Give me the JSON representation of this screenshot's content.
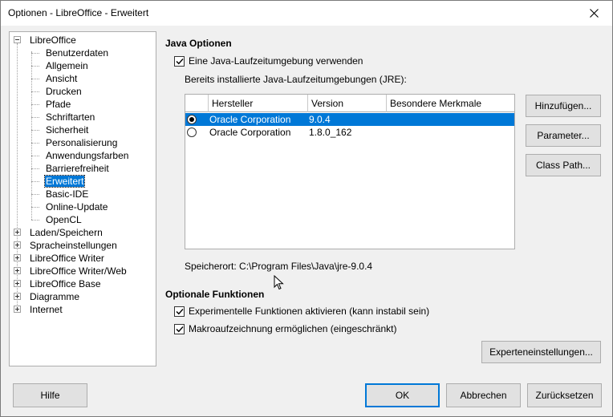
{
  "window": {
    "title": "Optionen - LibreOffice - Erweitert"
  },
  "tree": {
    "items": [
      {
        "label": "LibreOffice",
        "level": 0,
        "expander": "minus"
      },
      {
        "label": "Benutzerdaten",
        "level": 1
      },
      {
        "label": "Allgemein",
        "level": 1
      },
      {
        "label": "Ansicht",
        "level": 1
      },
      {
        "label": "Drucken",
        "level": 1
      },
      {
        "label": "Pfade",
        "level": 1
      },
      {
        "label": "Schriftarten",
        "level": 1
      },
      {
        "label": "Sicherheit",
        "level": 1
      },
      {
        "label": "Personalisierung",
        "level": 1
      },
      {
        "label": "Anwendungsfarben",
        "level": 1
      },
      {
        "label": "Barrierefreiheit",
        "level": 1
      },
      {
        "label": "Erweitert",
        "level": 1,
        "selected": true
      },
      {
        "label": "Basic-IDE",
        "level": 1
      },
      {
        "label": "Online-Update",
        "level": 1
      },
      {
        "label": "OpenCL",
        "level": 1
      },
      {
        "label": "Laden/Speichern",
        "level": 0,
        "expander": "plus"
      },
      {
        "label": "Spracheinstellungen",
        "level": 0,
        "expander": "plus"
      },
      {
        "label": "LibreOffice Writer",
        "level": 0,
        "expander": "plus"
      },
      {
        "label": "LibreOffice Writer/Web",
        "level": 0,
        "expander": "plus"
      },
      {
        "label": "LibreOffice Base",
        "level": 0,
        "expander": "plus"
      },
      {
        "label": "Diagramme",
        "level": 0,
        "expander": "plus"
      },
      {
        "label": "Internet",
        "level": 0,
        "expander": "plus"
      }
    ]
  },
  "java": {
    "section_title": "Java Optionen",
    "use_jre_label": "Eine Java-Laufzeitumgebung verwenden",
    "use_jre_checked": true,
    "installed_label": "Bereits installierte Java-Laufzeitumgebungen (JRE):",
    "columns": [
      "Hersteller",
      "Version",
      "Besondere Merkmale"
    ],
    "rows": [
      {
        "vendor": "Oracle Corporation",
        "version": "9.0.4",
        "features": "",
        "selected": true
      },
      {
        "vendor": "Oracle Corporation",
        "version": "1.8.0_162",
        "features": "",
        "selected": false
      }
    ],
    "buttons": {
      "add": "Hinzufügen...",
      "parameters": "Parameter...",
      "class_path": "Class Path..."
    },
    "location": "Speicherort: C:\\Program Files\\Java\\jre-9.0.4"
  },
  "optional": {
    "section_title": "Optionale Funktionen",
    "experimental_label": "Experimentelle Funktionen aktivieren (kann instabil sein)",
    "experimental_checked": true,
    "macro_label": "Makroaufzeichnung ermöglichen (eingeschränkt)",
    "macro_checked": true,
    "expert_button": "Experteneinstellungen..."
  },
  "footer": {
    "help": "Hilfe",
    "ok": "OK",
    "cancel": "Abbrechen",
    "reset": "Zurücksetzen"
  },
  "icons": {
    "close": "close-icon",
    "checkmark": "checkmark-icon",
    "cursor": "mouse-cursor-icon"
  }
}
